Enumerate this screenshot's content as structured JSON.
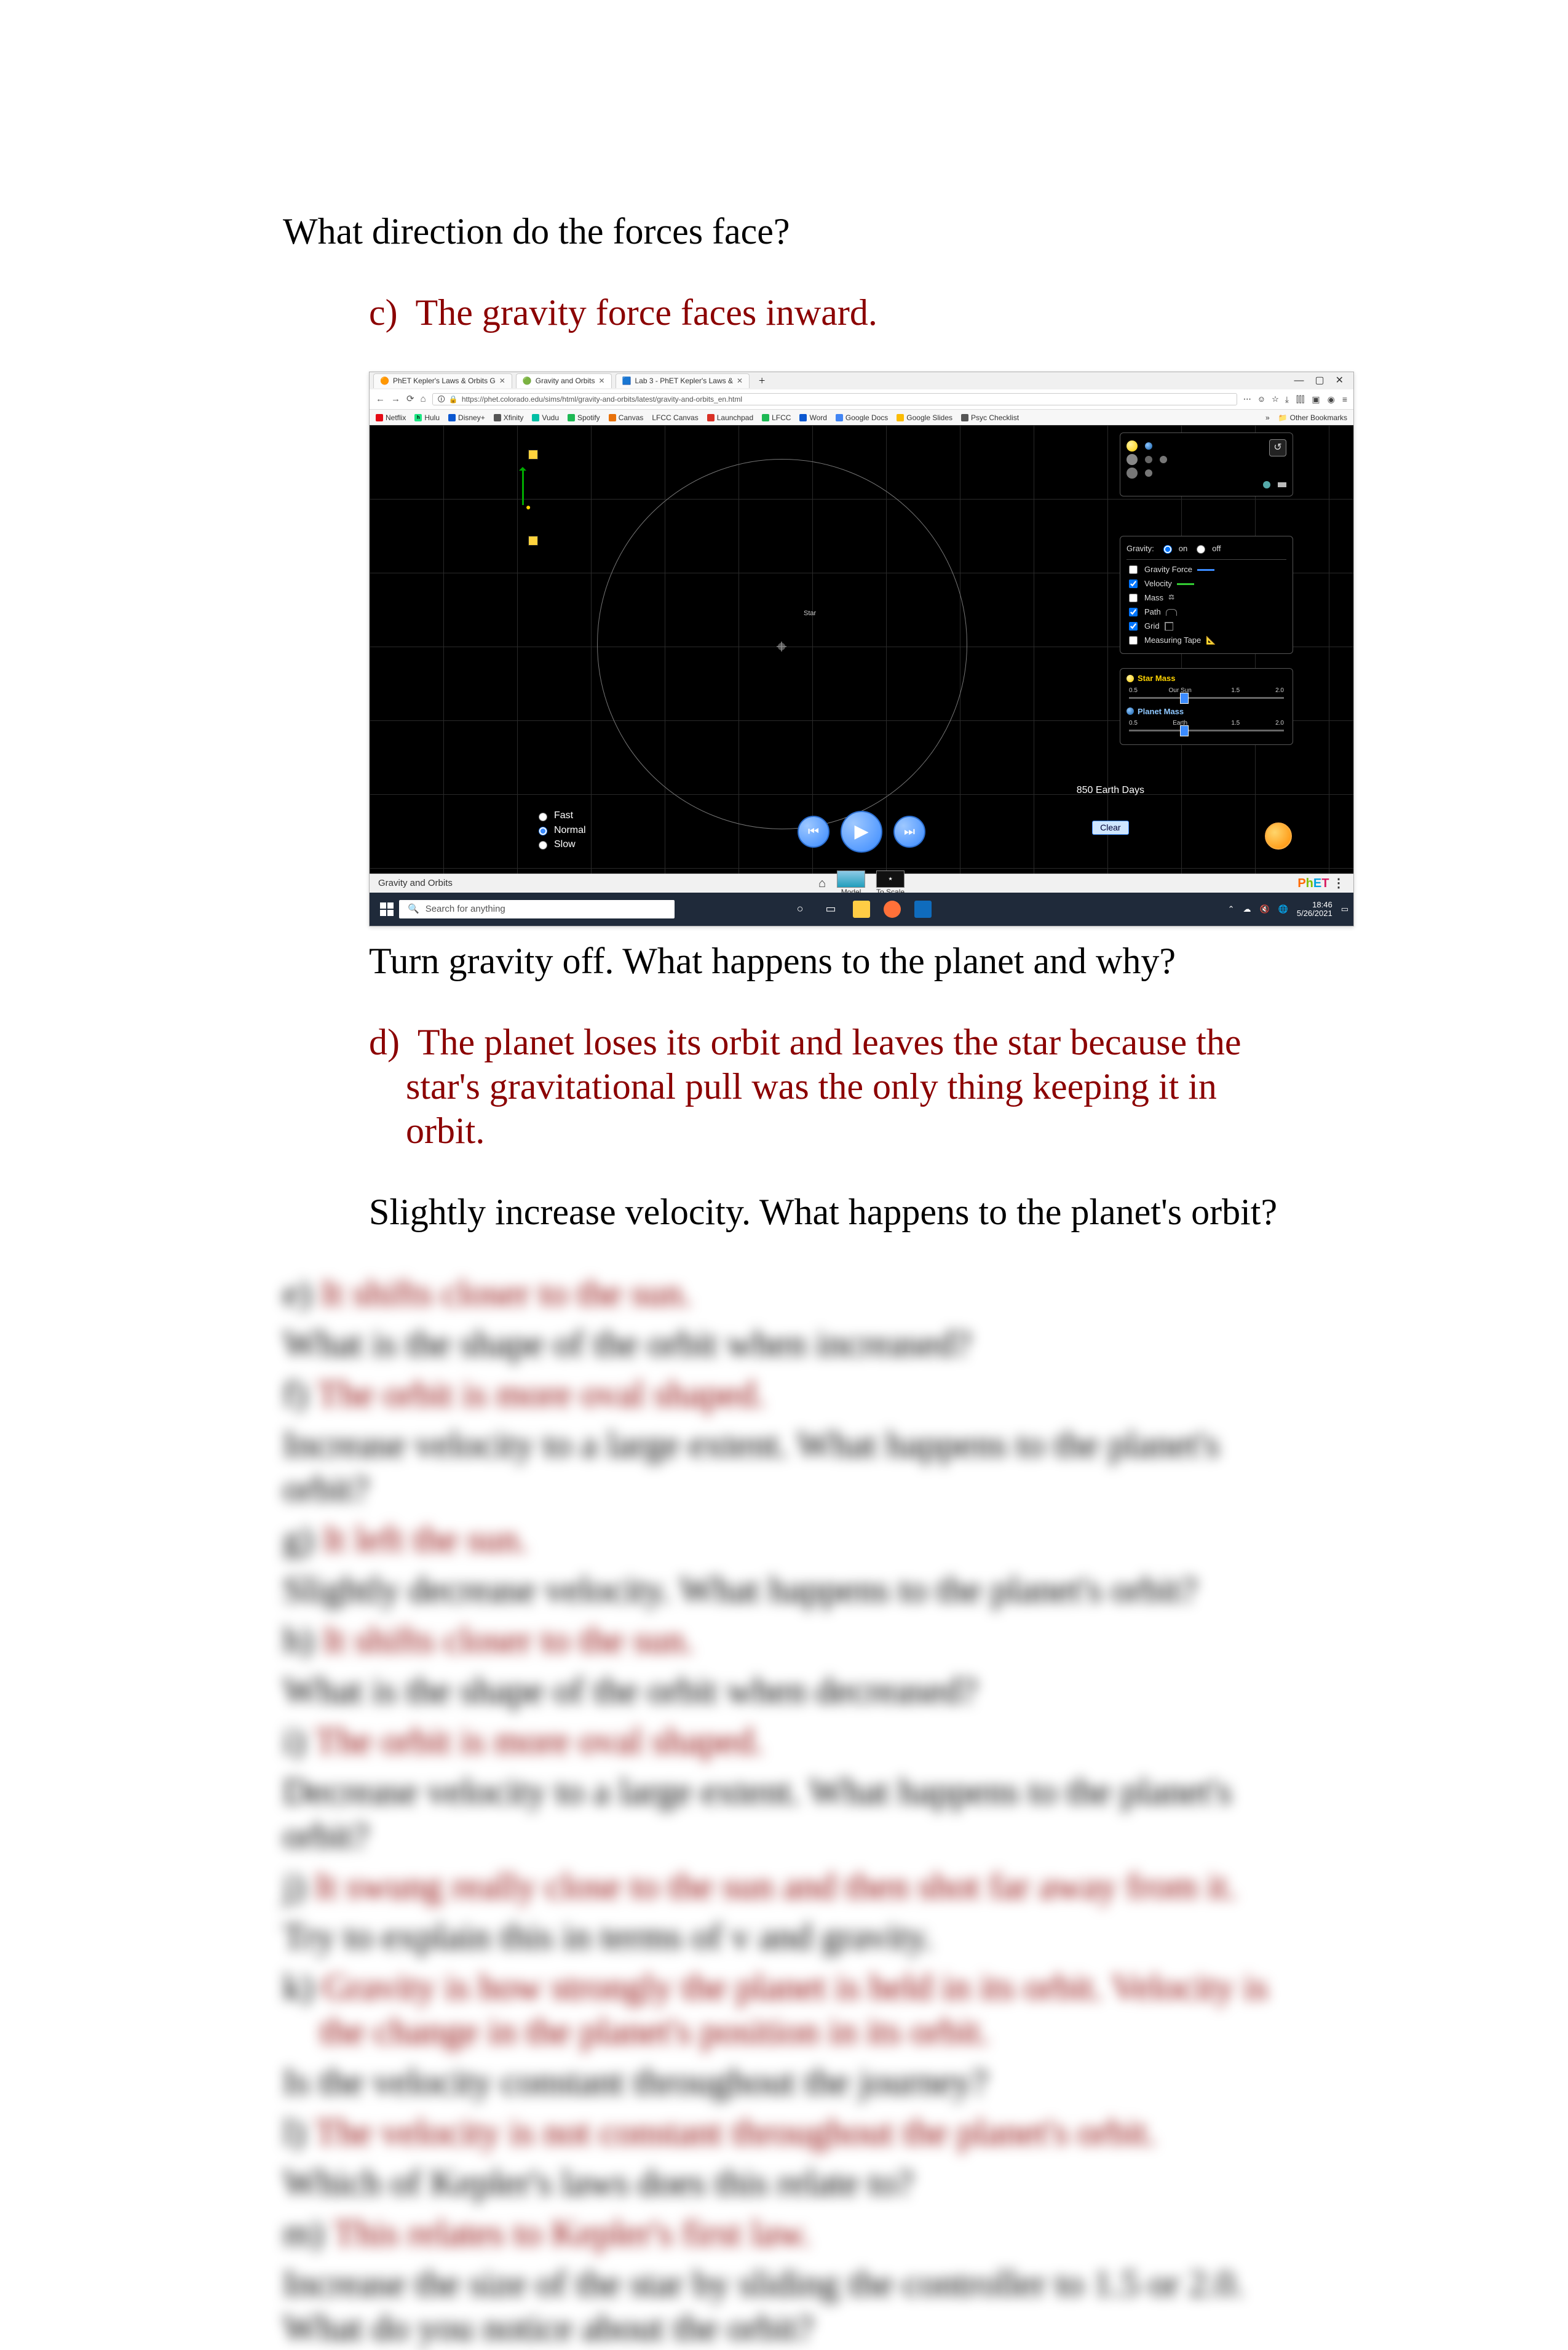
{
  "questions": {
    "q1": "What direction do the forces face?",
    "c_label": "c)",
    "c_answer": "The gravity force faces inward.",
    "q2": "Turn gravity off. What happens to the planet and why?",
    "d_label": "d)",
    "d_answer": "The planet loses its orbit and leaves the star because the star's gravitational pull was the only thing keeping it in orbit.",
    "q3": "Slightly increase velocity. What happens to the planet's orbit?"
  },
  "blurred": {
    "e_label": "e)",
    "e_ans": "It shifts closer to the sun.",
    "e_q": "What is the shape of the orbit when increased?",
    "f_label": "f)",
    "f_ans": "The orbit is more oval shaped.",
    "f_q": "Increase velocity to a large extent. What happens to the planet's orbit?",
    "g_label": "g)",
    "g_ans": "It left the sun.",
    "g_q": "Slightly decrease velocity. What happens to the planet's orbit?",
    "h_label": "h)",
    "h_ans": "It shifts closer to the sun.",
    "h_q": "What is the shape of the orbit when decreased?",
    "i_label": "i)",
    "i_ans": "The orbit is more oval shaped.",
    "i_q": "Decrease velocity to a large extent. What happens to the planet's orbit?",
    "j_label": "j)",
    "j_ans": "It swung really close to the sun and then shot far away from it.",
    "j_q": "Try to explain this in terms of v and gravity.",
    "k_label": "k)",
    "k_ans": "Gravity is how strongly the planet is held in its orbit. Velocity is the change in the planet's position in its orbit.",
    "k_q": "Is the velocity constant throughout the journey?",
    "l_label": "l)",
    "l_ans": "The velocity is not constant throughout the planet's orbit.",
    "l_q": "Which of Kepler's laws does this relate to?",
    "m_label": "m)",
    "m_ans": "This relates to Kepler's first law.",
    "m_q": "Increase the size of the star by sliding the controller to 1.5 or 2.0. What do you notice about the orbit?"
  },
  "browser": {
    "tabs": [
      "PhET Kepler's Laws & Orbits G",
      "Gravity and Orbits",
      "Lab 3 - PhET Kepler's Laws & "
    ],
    "url_secure": "🔒",
    "url": "https://phet.colorado.edu/sims/html/gravity-and-orbits/latest/gravity-and-orbits_en.html",
    "win_min": "—",
    "win_max": "▢",
    "win_close": "✕",
    "nav_back": "←",
    "nav_fwd": "→",
    "nav_reload": "⟳",
    "nav_home": "⌂",
    "url_shield": "🛈",
    "addr_dots": "⋯",
    "addr_smile": "☺",
    "addr_star": "☆",
    "tool_download": "⤓",
    "tool_library": "⫿⫿⫿",
    "tool_ext": "▣",
    "tool_acct": "◉",
    "tool_menu": "≡",
    "bm_chev": "»"
  },
  "bookmarks": {
    "b1": "Netflix",
    "b2": "Hulu",
    "b3": "Disney+",
    "b4": "Xfinity",
    "b5": "Vudu",
    "b6": "Spotify",
    "b7": "Canvas",
    "b8": "LFCC Canvas",
    "b9": "Launchpad",
    "b10": "LFCC",
    "b11": "Word",
    "b12": "Google Docs",
    "b13": "Google Slides",
    "b14": "Psyc Checklist",
    "other": "Other Bookmarks"
  },
  "sim": {
    "star_label": "Star",
    "speed_fast": "Fast",
    "speed_normal": "Normal",
    "speed_slow": "Slow",
    "rewind": "⏮",
    "play": "▶",
    "step": "⏭",
    "days": "850 Earth Days",
    "clear": "Clear",
    "reset": "↺",
    "gravity_label": "Gravity:",
    "gravity_on": "on",
    "gravity_off": "off",
    "chk_gforce": "Gravity Force",
    "chk_vel": "Velocity",
    "chk_mass": "Mass",
    "chk_path": "Path",
    "chk_grid": "Grid",
    "chk_tape": "Measuring Tape",
    "star_mass": "Star Mass",
    "our_sun": "Our Sun",
    "planet_mass": "Planet Mass",
    "earth_label": "Earth",
    "t05": "0.5",
    "t15": "1.5",
    "t20": "2.0",
    "foot_title": "Gravity and Orbits",
    "foot_model": "Model",
    "foot_scale": "To Scale",
    "home": "⌂",
    "phet_p": "P",
    "phet_h": "h",
    "phet_e": "E",
    "phet_t": "T",
    "phet_menu": "⋮"
  },
  "taskbar": {
    "search_placeholder": "Search for anything",
    "search_icon": "🔍",
    "cortana": "○",
    "taskview": "▭",
    "tray_up": "⌃",
    "cloud": "☁",
    "speaker": "🔇",
    "time": "18:46",
    "date": "5/26/2021",
    "notif": "▭"
  }
}
